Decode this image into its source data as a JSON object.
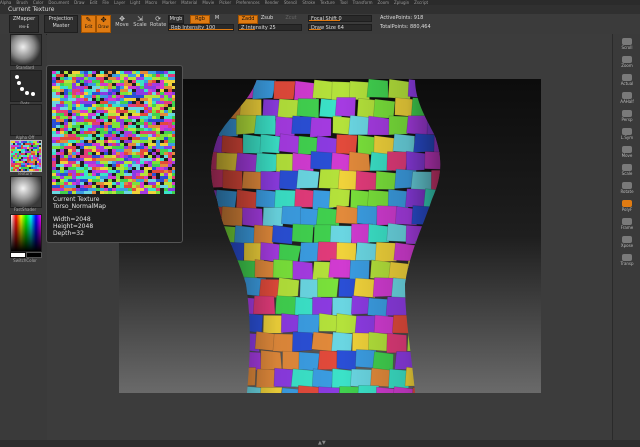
{
  "menubar": {
    "items": [
      "Alpha",
      "Brush",
      "Color",
      "Document",
      "Draw",
      "Edit",
      "File",
      "Layer",
      "Light",
      "Macro",
      "Marker",
      "Material",
      "Movie",
      "Picker",
      "Preferences",
      "Render",
      "Stencil",
      "Stroke",
      "Texture",
      "Tool",
      "Transform",
      "Zoom",
      "Zplugin",
      "Zscript"
    ]
  },
  "title": "Current Texture",
  "toolbar": {
    "zmapper_label": "ZMapper",
    "zmapper_version": "rev-E",
    "projection_label": "Projection",
    "projection_sub": "Master",
    "edit_label": "Edit",
    "draw_label": "Draw",
    "move_label": "Move",
    "scale_label": "Scale",
    "rotate_label": "Rotate",
    "mrgb_label": "Mrgb",
    "rgb_label": "Rgb",
    "m_label": "M",
    "zadd_label": "Zadd",
    "zsub_label": "Zsub",
    "zcut_label": "Zcut",
    "rgb_intensity_label": "Rgb Intensity",
    "rgb_intensity_value": "100",
    "z_intensity_label": "Z Intensity",
    "z_intensity_value": "25",
    "focal_shift_label": "Focal Shift",
    "focal_shift_value": "0",
    "draw_size_label": "Draw Size",
    "draw_size_value": "64",
    "active_points_label": "ActivePoints:",
    "active_points_value": "918",
    "total_points_label": "TotalPoints:",
    "total_points_value": "880,464",
    "high_label": "High"
  },
  "leftshelf": {
    "slot1": "Standard",
    "slot2": "Dots",
    "slot3": "Alpha Off",
    "slot4": "Texture",
    "slot5": "FastShader",
    "switch_color": "SwitchColor"
  },
  "rightshelf": {
    "items": [
      "Scroll",
      "Zoom",
      "Actual",
      "AAHalf",
      "Persp",
      "L.Sym",
      "Move",
      "Scale",
      "Rotate",
      "PolyF",
      "Frame",
      "Xpose",
      "Transp"
    ]
  },
  "popup": {
    "title": "Current Texture",
    "name": "Torso_NormalMap",
    "width": "Width=2048",
    "height": "Height=2048",
    "depth": "Depth=32"
  },
  "colors": {
    "accent": "#e07b12",
    "background": "#3a3a3a"
  }
}
